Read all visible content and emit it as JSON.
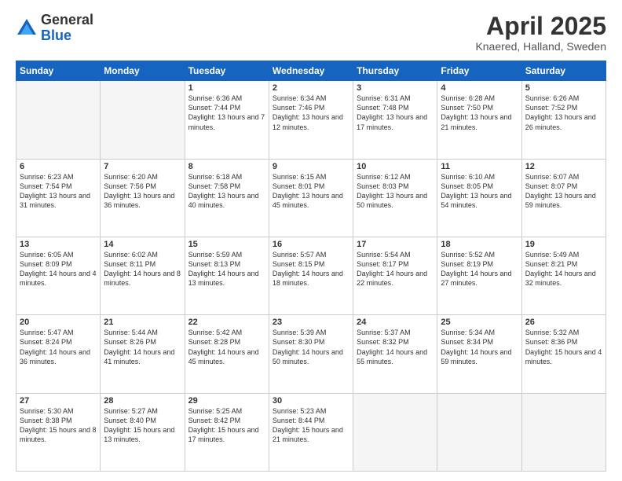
{
  "logo": {
    "general": "General",
    "blue": "Blue"
  },
  "header": {
    "month": "April 2025",
    "location": "Knaered, Halland, Sweden"
  },
  "weekdays": [
    "Sunday",
    "Monday",
    "Tuesday",
    "Wednesday",
    "Thursday",
    "Friday",
    "Saturday"
  ],
  "weeks": [
    [
      {
        "day": "",
        "info": ""
      },
      {
        "day": "",
        "info": ""
      },
      {
        "day": "1",
        "info": "Sunrise: 6:36 AM\nSunset: 7:44 PM\nDaylight: 13 hours and 7 minutes."
      },
      {
        "day": "2",
        "info": "Sunrise: 6:34 AM\nSunset: 7:46 PM\nDaylight: 13 hours and 12 minutes."
      },
      {
        "day": "3",
        "info": "Sunrise: 6:31 AM\nSunset: 7:48 PM\nDaylight: 13 hours and 17 minutes."
      },
      {
        "day": "4",
        "info": "Sunrise: 6:28 AM\nSunset: 7:50 PM\nDaylight: 13 hours and 21 minutes."
      },
      {
        "day": "5",
        "info": "Sunrise: 6:26 AM\nSunset: 7:52 PM\nDaylight: 13 hours and 26 minutes."
      }
    ],
    [
      {
        "day": "6",
        "info": "Sunrise: 6:23 AM\nSunset: 7:54 PM\nDaylight: 13 hours and 31 minutes."
      },
      {
        "day": "7",
        "info": "Sunrise: 6:20 AM\nSunset: 7:56 PM\nDaylight: 13 hours and 36 minutes."
      },
      {
        "day": "8",
        "info": "Sunrise: 6:18 AM\nSunset: 7:58 PM\nDaylight: 13 hours and 40 minutes."
      },
      {
        "day": "9",
        "info": "Sunrise: 6:15 AM\nSunset: 8:01 PM\nDaylight: 13 hours and 45 minutes."
      },
      {
        "day": "10",
        "info": "Sunrise: 6:12 AM\nSunset: 8:03 PM\nDaylight: 13 hours and 50 minutes."
      },
      {
        "day": "11",
        "info": "Sunrise: 6:10 AM\nSunset: 8:05 PM\nDaylight: 13 hours and 54 minutes."
      },
      {
        "day": "12",
        "info": "Sunrise: 6:07 AM\nSunset: 8:07 PM\nDaylight: 13 hours and 59 minutes."
      }
    ],
    [
      {
        "day": "13",
        "info": "Sunrise: 6:05 AM\nSunset: 8:09 PM\nDaylight: 14 hours and 4 minutes."
      },
      {
        "day": "14",
        "info": "Sunrise: 6:02 AM\nSunset: 8:11 PM\nDaylight: 14 hours and 8 minutes."
      },
      {
        "day": "15",
        "info": "Sunrise: 5:59 AM\nSunset: 8:13 PM\nDaylight: 14 hours and 13 minutes."
      },
      {
        "day": "16",
        "info": "Sunrise: 5:57 AM\nSunset: 8:15 PM\nDaylight: 14 hours and 18 minutes."
      },
      {
        "day": "17",
        "info": "Sunrise: 5:54 AM\nSunset: 8:17 PM\nDaylight: 14 hours and 22 minutes."
      },
      {
        "day": "18",
        "info": "Sunrise: 5:52 AM\nSunset: 8:19 PM\nDaylight: 14 hours and 27 minutes."
      },
      {
        "day": "19",
        "info": "Sunrise: 5:49 AM\nSunset: 8:21 PM\nDaylight: 14 hours and 32 minutes."
      }
    ],
    [
      {
        "day": "20",
        "info": "Sunrise: 5:47 AM\nSunset: 8:24 PM\nDaylight: 14 hours and 36 minutes."
      },
      {
        "day": "21",
        "info": "Sunrise: 5:44 AM\nSunset: 8:26 PM\nDaylight: 14 hours and 41 minutes."
      },
      {
        "day": "22",
        "info": "Sunrise: 5:42 AM\nSunset: 8:28 PM\nDaylight: 14 hours and 45 minutes."
      },
      {
        "day": "23",
        "info": "Sunrise: 5:39 AM\nSunset: 8:30 PM\nDaylight: 14 hours and 50 minutes."
      },
      {
        "day": "24",
        "info": "Sunrise: 5:37 AM\nSunset: 8:32 PM\nDaylight: 14 hours and 55 minutes."
      },
      {
        "day": "25",
        "info": "Sunrise: 5:34 AM\nSunset: 8:34 PM\nDaylight: 14 hours and 59 minutes."
      },
      {
        "day": "26",
        "info": "Sunrise: 5:32 AM\nSunset: 8:36 PM\nDaylight: 15 hours and 4 minutes."
      }
    ],
    [
      {
        "day": "27",
        "info": "Sunrise: 5:30 AM\nSunset: 8:38 PM\nDaylight: 15 hours and 8 minutes."
      },
      {
        "day": "28",
        "info": "Sunrise: 5:27 AM\nSunset: 8:40 PM\nDaylight: 15 hours and 13 minutes."
      },
      {
        "day": "29",
        "info": "Sunrise: 5:25 AM\nSunset: 8:42 PM\nDaylight: 15 hours and 17 minutes."
      },
      {
        "day": "30",
        "info": "Sunrise: 5:23 AM\nSunset: 8:44 PM\nDaylight: 15 hours and 21 minutes."
      },
      {
        "day": "",
        "info": ""
      },
      {
        "day": "",
        "info": ""
      },
      {
        "day": "",
        "info": ""
      }
    ]
  ]
}
